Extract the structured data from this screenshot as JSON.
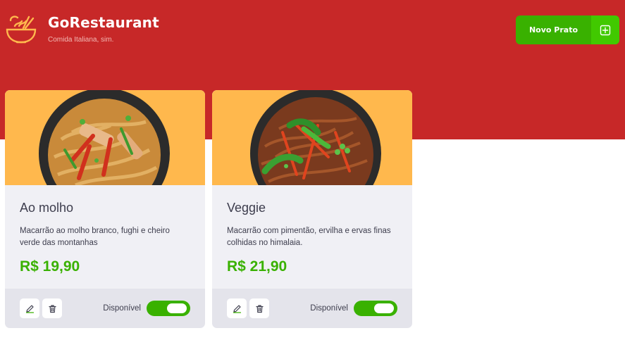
{
  "header": {
    "title": "GoRestaurant",
    "subtitle": "Comida Italiana, sim.",
    "new_button_label": "Novo Prato",
    "new_button_icon": "plus-square-icon",
    "logo_icon": "noodle-bowl-icon"
  },
  "colors": {
    "header": "#c72828",
    "accent_green": "#39b100",
    "card_image_bg": "#ffb84d",
    "card_bg": "#f0f0f5",
    "footer_bg": "#e4e4eb",
    "text": "#3d3d4d"
  },
  "foods": [
    {
      "name": "Ao molho",
      "description": "Macarrão ao molho branco, fughi e cheiro verde das montanhas",
      "price": "R$ 19,90",
      "available_label": "Disponível",
      "available": true,
      "image_icon": "pasta-bowl-icon"
    },
    {
      "name": "Veggie",
      "description": "Macarrão com pimentão, ervilha e ervas finas colhidas no himalaia.",
      "price": "R$ 21,90",
      "available_label": "Disponível",
      "available": true,
      "image_icon": "veggie-pasta-bowl-icon"
    }
  ]
}
